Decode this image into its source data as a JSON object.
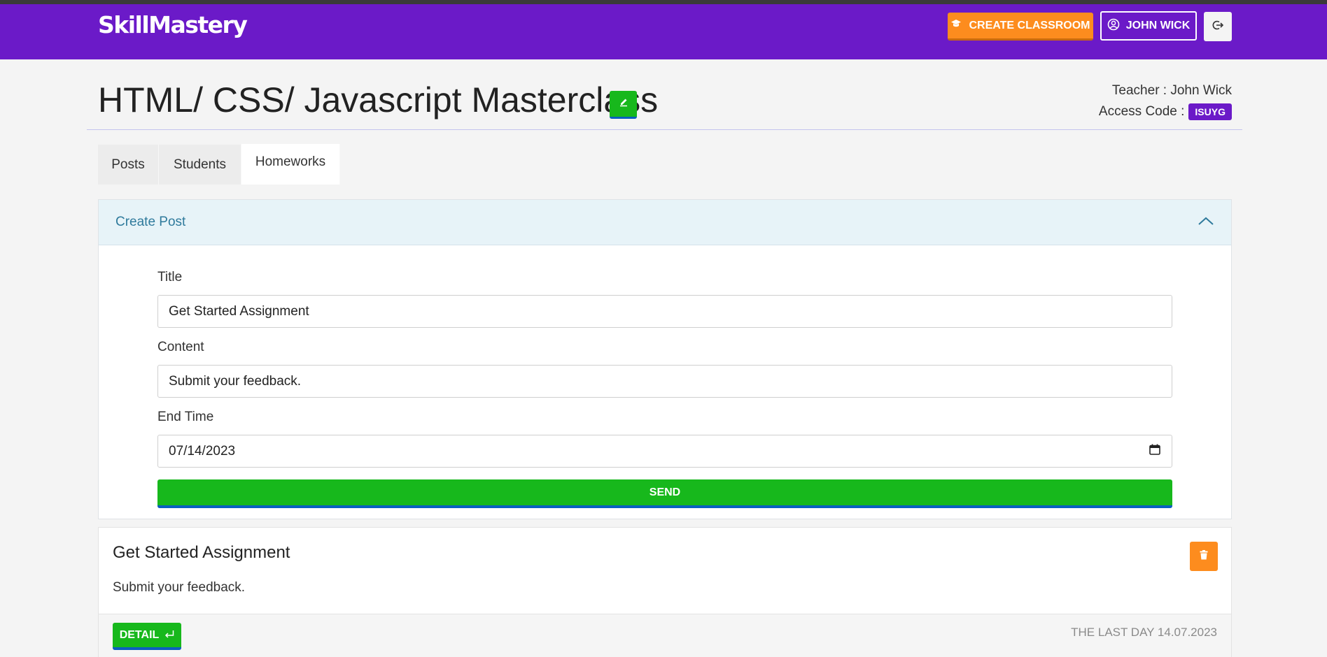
{
  "brand": "SkillMastery",
  "header": {
    "create_classroom_label": "CREATE CLASSROOM",
    "user_label": "JOHN WICK"
  },
  "classroom": {
    "title": "HTML/ CSS/ Javascript Masterclass",
    "teacher": "Teacher : John Wick",
    "access_code_label": "Access Code :",
    "access_code": "ISUYG"
  },
  "tabs": [
    {
      "label": "Posts",
      "active": false
    },
    {
      "label": "Students",
      "active": false
    },
    {
      "label": "Homeworks",
      "active": true
    }
  ],
  "create_post": {
    "heading": "Create Post",
    "title_label": "Title",
    "title_value": "Get Started Assignment",
    "content_label": "Content",
    "content_value": "Submit your feedback.",
    "end_time_label": "End Time",
    "end_time_value": "07/14/2023",
    "send_label": "SEND"
  },
  "posts": [
    {
      "title": "Get Started Assignment",
      "content": "Submit your feedback.",
      "detail_label": "DETAIL",
      "last_day": "THE LAST DAY 14.07.2023"
    }
  ],
  "colors": {
    "brand": "#6b1ac8",
    "orange": "#fd8c1e",
    "green": "#17b81c",
    "info_bg": "#e7f3f8"
  }
}
